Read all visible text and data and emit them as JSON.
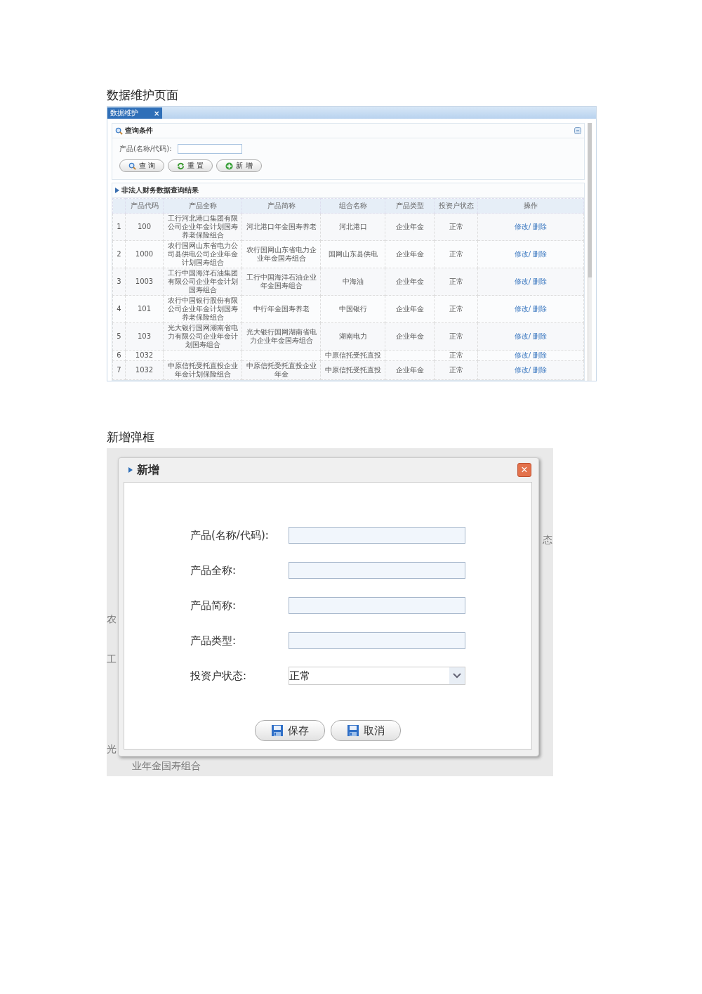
{
  "sections": [
    {
      "heading": "数据维护页面"
    },
    {
      "heading": "新增弹框"
    }
  ],
  "maintenance": {
    "tab": {
      "label": "数据维护",
      "close": "×",
      "selected": true
    },
    "query": {
      "title": "查询条件",
      "field_label": "产品(名称/代码):",
      "buttons": [
        {
          "kind": "search",
          "label": "查 询"
        },
        {
          "kind": "reset",
          "label": "重 置"
        },
        {
          "kind": "add",
          "label": "新 增"
        }
      ]
    },
    "results": {
      "title": "非法人财务数据查询结果",
      "columns": [
        "产品代码",
        "产品全称",
        "产品简称",
        "组合名称",
        "产品类型",
        "投资户状态",
        "操作"
      ],
      "rows": [
        {
          "index": "1",
          "code": "100",
          "full_name": "工行河北港口集团有限公司企业年金计划国寿养老保险组合",
          "short_name": "河北港口年金国寿养老",
          "combo": "河北港口",
          "type": "企业年金",
          "status": "正常",
          "edit": "修改/",
          "delete": "删除"
        },
        {
          "index": "2",
          "code": "1000",
          "full_name": "农行国网山东省电力公司县供电公司企业年金计划国寿组合",
          "short_name": "农行国网山东省电力企业年金国寿组合",
          "combo": "国网山东县供电",
          "type": "企业年金",
          "status": "正常",
          "edit": "修改/",
          "delete": "删除"
        },
        {
          "index": "3",
          "code": "1003",
          "full_name": "工行中国海洋石油集团有限公司企业年金计划国寿组合",
          "short_name": "工行中国海洋石油企业年金国寿组合",
          "combo": "中海油",
          "type": "企业年金",
          "status": "正常",
          "edit": "修改/",
          "delete": "删除"
        },
        {
          "index": "4",
          "code": "101",
          "full_name": "农行中国银行股份有限公司企业年金计划国寿养老保险组合",
          "short_name": "中行年金国寿养老",
          "combo": "中国银行",
          "type": "企业年金",
          "status": "正常",
          "edit": "修改/",
          "delete": "删除"
        },
        {
          "index": "5",
          "code": "103",
          "full_name": "光大银行国网湖南省电力有限公司企业年金计划国寿组合",
          "short_name": "光大银行国网湖南省电力企业年金国寿组合",
          "combo": "湖南电力",
          "type": "企业年金",
          "status": "正常",
          "edit": "修改/",
          "delete": "删除"
        },
        {
          "index": "6",
          "code": "1032",
          "combo": "中原信托受托直投",
          "status": "正常",
          "edit": "修改/",
          "delete": "删除"
        },
        {
          "index": "7",
          "code": "1032",
          "full_name": "中原信托受托直投企业年金计划保险组合",
          "short_name": "中原信托受托直投企业年金",
          "combo": "中原信托受托直投",
          "type": "企业年金",
          "status": "正常",
          "edit": "修改/",
          "delete": "删除"
        }
      ]
    }
  },
  "dialog": {
    "title": "新增",
    "close": "×",
    "fields": [
      {
        "kind": "text",
        "label": "产品(名称/代码):"
      },
      {
        "kind": "text",
        "label": "产品全称:"
      },
      {
        "kind": "text",
        "label": "产品简称:"
      },
      {
        "kind": "text",
        "label": "产品类型:"
      },
      {
        "kind": "select",
        "label": "投资户状态:",
        "value": "正常"
      }
    ],
    "buttons": [
      {
        "label": "保存"
      },
      {
        "label": "取消"
      }
    ],
    "backdrop_texts": [
      "农",
      "工",
      "光",
      "态",
      "业年金国寿组合"
    ]
  }
}
